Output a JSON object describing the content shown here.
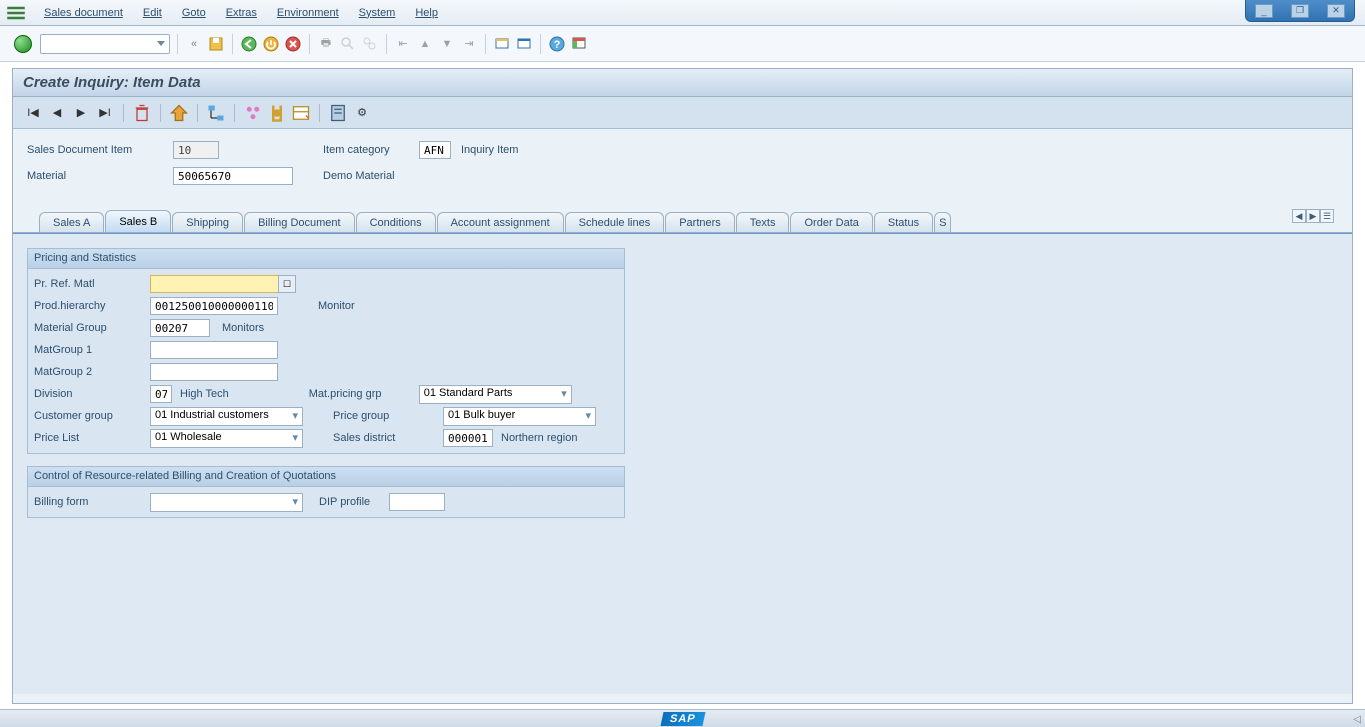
{
  "menu": {
    "items": [
      "Sales document",
      "Edit",
      "Goto",
      "Extras",
      "Environment",
      "System",
      "Help"
    ]
  },
  "title": "Create Inquiry: Item Data",
  "header": {
    "sales_doc_item_label": "Sales Document Item",
    "sales_doc_item": "10",
    "item_cat_label": "Item category",
    "item_cat": "AFN",
    "item_cat_text": "Inquiry Item",
    "material_label": "Material",
    "material": "50065670",
    "material_text": "Demo Material"
  },
  "tabs": [
    "Sales A",
    "Sales B",
    "Shipping",
    "Billing Document",
    "Conditions",
    "Account assignment",
    "Schedule lines",
    "Partners",
    "Texts",
    "Order Data",
    "Status",
    "S"
  ],
  "active_tab": 1,
  "grp1": {
    "title": "Pricing and Statistics",
    "pr_ref_matl_label": "Pr. Ref. Matl",
    "pr_ref_matl": "",
    "prod_hier_label": "Prod.hierarchy",
    "prod_hier": "001250010000000110",
    "prod_hier_text": "Monitor",
    "mat_group_label": "Material Group",
    "mat_group": "00207",
    "mat_group_text": "Monitors",
    "matgroup1_label": "MatGroup 1",
    "matgroup1": "",
    "matgroup2_label": "MatGroup 2",
    "matgroup2": "",
    "division_label": "Division",
    "division": "07",
    "division_text": "High Tech",
    "mat_price_grp_label": "Mat.pricing grp",
    "mat_price_grp": "01 Standard Parts",
    "cust_group_label": "Customer group",
    "cust_group": "01 Industrial customers",
    "price_group_label": "Price group",
    "price_group": "01 Bulk buyer",
    "price_list_label": "Price List",
    "price_list": "01 Wholesale",
    "sales_district_label": "Sales district",
    "sales_district": "000001",
    "sales_district_text": "Northern region"
  },
  "grp2": {
    "title": "Control of Resource-related Billing and Creation of Quotations",
    "billing_form_label": "Billing form",
    "billing_form": "",
    "dip_profile_label": "DIP profile",
    "dip_profile": ""
  },
  "icons": {
    "save": "save-icon",
    "back": "back-icon",
    "exit": "exit-icon",
    "cancel": "cancel-icon"
  }
}
